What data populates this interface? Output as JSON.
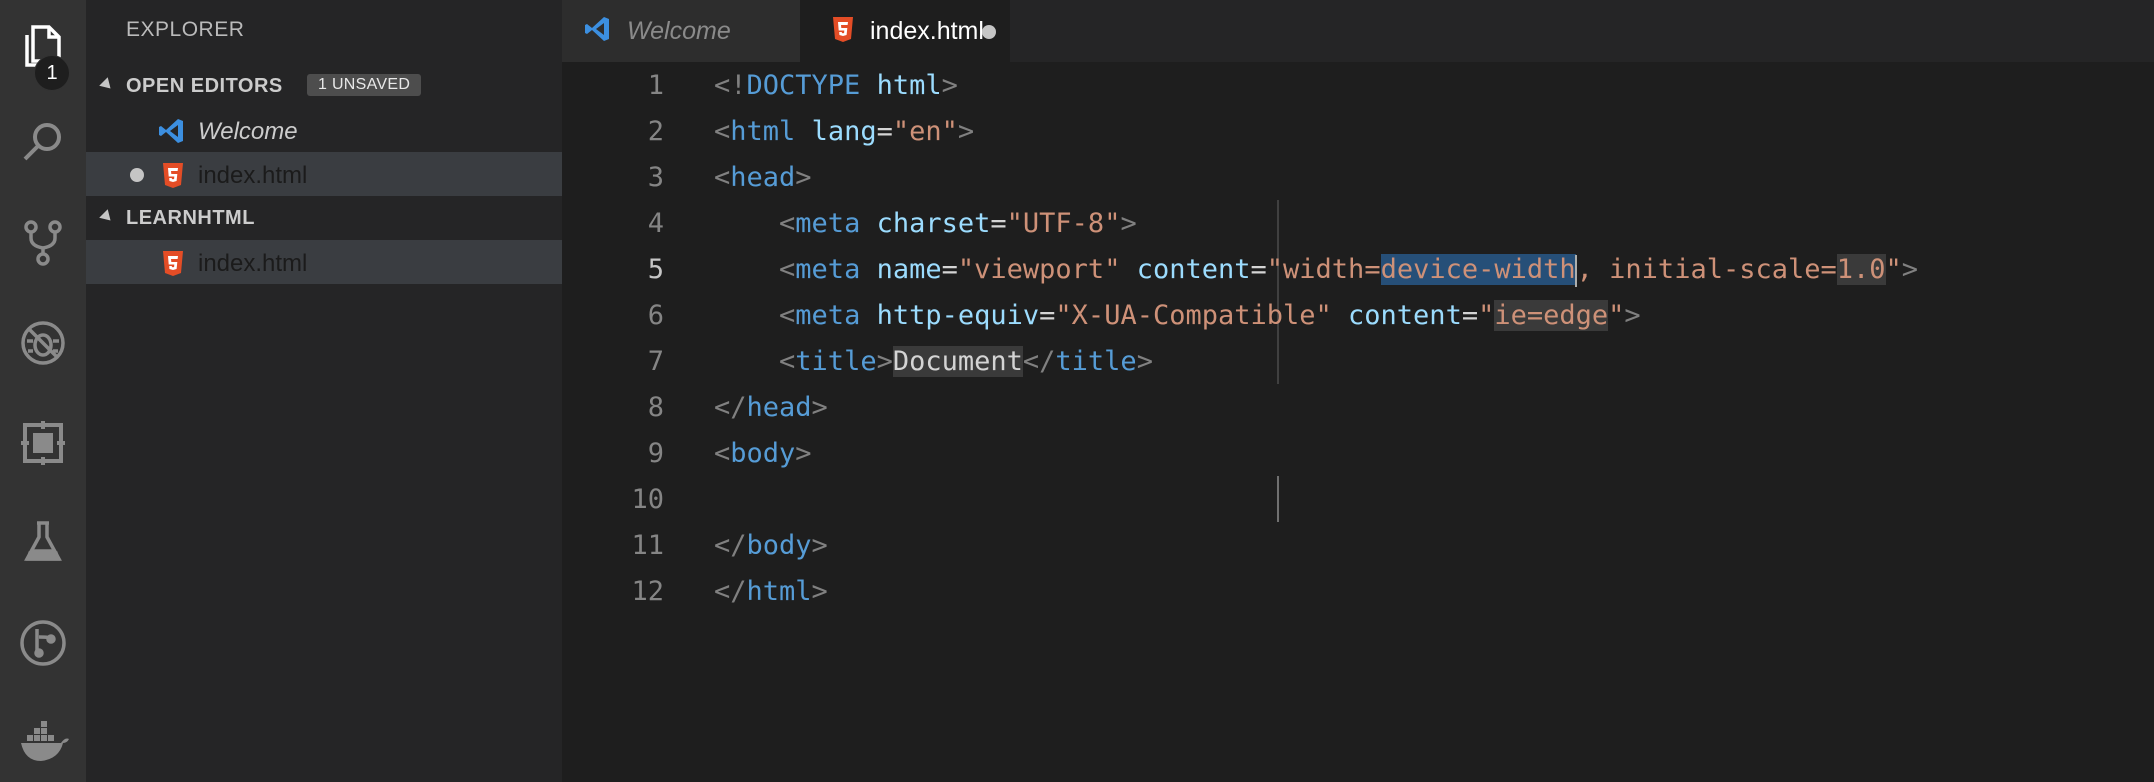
{
  "activity_bar": {
    "items": [
      "explorer-icon",
      "search-icon",
      "source-control-icon",
      "debug-icon",
      "extensions-icon",
      "test-icon",
      "git-graph-icon",
      "docker-icon"
    ],
    "explorer_badge": "1"
  },
  "sidebar": {
    "title": "EXPLORER",
    "open_editors": {
      "title": "OPEN EDITORS",
      "badge": "1 UNSAVED",
      "items": [
        {
          "label": "Welcome",
          "icon": "vscode-icon"
        },
        {
          "label": "index.html",
          "icon": "html5-icon",
          "unsaved": true
        }
      ]
    },
    "folder": {
      "title": "LEARNHTML",
      "items": [
        {
          "label": "index.html",
          "icon": "html5-icon"
        }
      ]
    }
  },
  "tabs": [
    {
      "label": "Welcome",
      "icon": "vscode-icon"
    },
    {
      "label": "index.html",
      "icon": "html5-icon",
      "active": true,
      "unsaved": true
    }
  ],
  "editor": {
    "current_line": 5,
    "line_numbers": [
      "1",
      "2",
      "3",
      "4",
      "5",
      "6",
      "7",
      "8",
      "9",
      "10",
      "11",
      "12"
    ],
    "tokens": {
      "l1": [
        "<!",
        "DOCTYPE",
        " ",
        "html",
        ">"
      ],
      "l2": [
        "<",
        "html",
        " ",
        "lang",
        "=",
        "\"en\"",
        ">"
      ],
      "l3": [
        "<",
        "head",
        ">"
      ],
      "l4": [
        "    ",
        "<",
        "meta",
        " ",
        "charset",
        "=",
        "\"UTF-8\"",
        ">"
      ],
      "l5": [
        "    ",
        "<",
        "meta",
        " ",
        "name",
        "=",
        "\"viewport\"",
        " ",
        "content",
        "=",
        "\"width=",
        "device-width",
        ", initial-scale=",
        "1.0",
        "\"",
        ">"
      ],
      "l6": [
        "    ",
        "<",
        "meta",
        " ",
        "http-equiv",
        "=",
        "\"X-UA-Compatible\"",
        " ",
        "content",
        "=",
        "\"",
        "ie=edge",
        "\"",
        ">"
      ],
      "l7": [
        "    ",
        "<",
        "title",
        ">",
        "Document",
        "</",
        "title",
        ">"
      ],
      "l8": [
        "</",
        "head",
        ">"
      ],
      "l9": [
        "<",
        "body",
        ">"
      ],
      "l10": [
        ""
      ],
      "l11": [
        "</",
        "body",
        ">"
      ],
      "l12": [
        "</",
        "html",
        ">"
      ]
    }
  },
  "colors": {
    "tag": "#569cd6",
    "attribute": "#9cdcfe",
    "string": "#ce9178",
    "bracket": "#808080",
    "selection": "#264f78"
  }
}
